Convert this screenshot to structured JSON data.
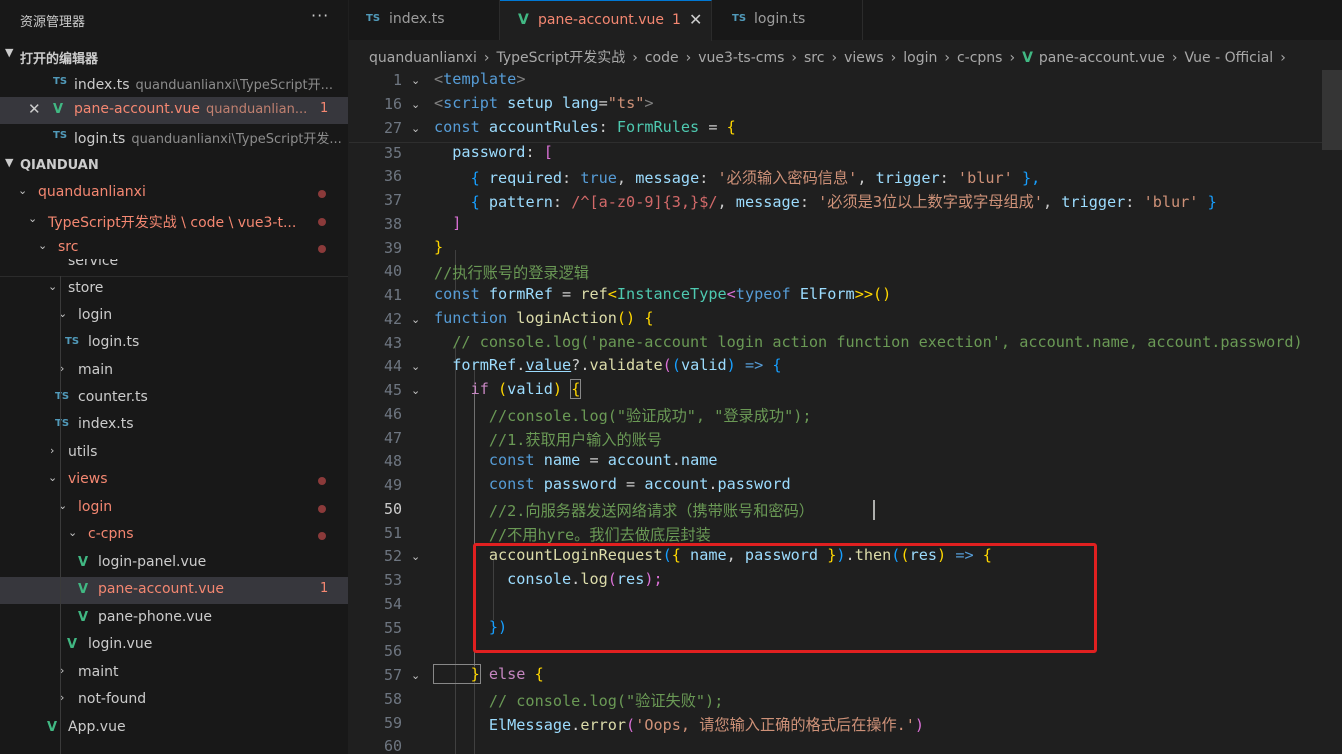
{
  "sidebar": {
    "title": "资源管理器",
    "more": "···",
    "open_editors_header": "打开的编辑器",
    "open_editors": [
      {
        "icon": "TS",
        "name": "index.ts",
        "desc": "quanduanlianxi\\TypeScript开..."
      },
      {
        "icon": "V",
        "name": "pane-account.vue",
        "desc": "quanduanlian...",
        "count": "1",
        "close": "✕"
      },
      {
        "icon": "TS",
        "name": "login.ts",
        "desc": "quanduanlianxi\\TypeScript开发..."
      }
    ],
    "workspace_header": "QIANDUAN",
    "tree": [
      {
        "label": "quanduanlianxi"
      },
      {
        "label": "TypeScript开发实战 \\ code \\ vue3-t..."
      },
      {
        "label": "src"
      },
      {
        "label": "service"
      },
      {
        "label": "store"
      },
      {
        "label": "login"
      },
      {
        "label": "login.ts",
        "icon": "TS"
      },
      {
        "label": "main"
      },
      {
        "label": "counter.ts",
        "icon": "TS"
      },
      {
        "label": "index.ts",
        "icon": "TS"
      },
      {
        "label": "utils"
      },
      {
        "label": "views"
      },
      {
        "label": "login"
      },
      {
        "label": "c-cpns"
      },
      {
        "label": "login-panel.vue",
        "icon": "V"
      },
      {
        "label": "pane-account.vue",
        "icon": "V",
        "count": "1"
      },
      {
        "label": "pane-phone.vue",
        "icon": "V"
      },
      {
        "label": "login.vue",
        "icon": "V"
      },
      {
        "label": "maint"
      },
      {
        "label": "not-found"
      },
      {
        "label": "App.vue",
        "icon": "V"
      }
    ]
  },
  "tabs": [
    {
      "icon": "TS",
      "label": "index.ts"
    },
    {
      "icon": "V",
      "label": "pane-account.vue",
      "count": "1",
      "close": "✕"
    },
    {
      "icon": "TS",
      "label": "login.ts"
    }
  ],
  "breadcrumb": [
    "quanduanlianxi",
    "TypeScript开发实战",
    "code",
    "vue3-ts-cms",
    "src",
    "views",
    "login",
    "c-cpns",
    "pane-account.vue",
    "Vue - Official"
  ],
  "editor": {
    "line_numbers": [
      "1",
      "16",
      "27",
      "35",
      "36",
      "37",
      "38",
      "39",
      "40",
      "41",
      "42",
      "43",
      "44",
      "45",
      "46",
      "47",
      "48",
      "49",
      "50",
      "51",
      "52",
      "53",
      "54",
      "55",
      "56",
      "57",
      "58",
      "59",
      "60"
    ],
    "lines": {
      "l1_a": "<",
      "l1_b": "template",
      "l1_c": ">",
      "l16_a": "<",
      "l16_b": "script",
      "l16_c": " setup",
      "l16_d": " lang",
      "l16_e": "=",
      "l16_f": "\"ts\"",
      "l16_g": ">",
      "l27_a": "const",
      "l27_b": " accountRules",
      "l27_c": ": ",
      "l27_d": "FormRules",
      "l27_e": " = ",
      "l27_f": "{",
      "l35_a": "  password",
      "l35_b": ": ",
      "l35_c": "[",
      "l36_a": "    { ",
      "l36_b": "required",
      "l36_c": ": ",
      "l36_d": "true",
      "l36_e": ", ",
      "l36_f": "message",
      "l36_g": ": ",
      "l36_h": "'必须输入密码信息'",
      "l36_i": ", ",
      "l36_j": "trigger",
      "l36_k": ": ",
      "l36_l": "'blur'",
      "l36_m": " },",
      "l37_a": "    { ",
      "l37_b": "pattern",
      "l37_c": ": ",
      "l37_d": "/^[a-z0-9]{3,}$/",
      "l37_e": ", ",
      "l37_f": "message",
      "l37_g": ": ",
      "l37_h": "'必须是3位以上数字或字母组成'",
      "l37_i": ", ",
      "l37_j": "trigger",
      "l37_k": ": ",
      "l37_l": "'blur'",
      "l37_m": " }",
      "l38_a": "  ]",
      "l39_a": "}",
      "l40_a": "//执行账号的登录逻辑",
      "l41_a": "const",
      "l41_b": " formRef",
      "l41_c": " = ",
      "l41_d": "ref",
      "l41_e": "<",
      "l41_f": "InstanceType",
      "l41_g": "<",
      "l41_h": "typeof",
      "l41_i": " ElForm",
      "l41_j": ">>",
      "l41_k": "()",
      "l42_a": "function",
      "l42_b": " loginAction",
      "l42_c": "()",
      "l42_d": " {",
      "l43_a": "  // console.log('pane-account login action function exection', account.name, account.password)",
      "l44_a": "  formRef",
      "l44_b": ".",
      "l44_c": "value",
      "l44_d": "?.",
      "l44_e": "validate",
      "l44_f": "(",
      "l44_g": "(",
      "l44_h": "valid",
      "l44_i": ")",
      "l44_j": " => ",
      "l44_k": "{",
      "l45_a": "    if",
      "l45_b": " (",
      "l45_c": "valid",
      "l45_d": ") ",
      "l45_e": "{",
      "l46_a": "      //console.log(\"验证成功\", \"登录成功\");",
      "l47_a": "      //1.获取用户输入的账号",
      "l48_a": "      const",
      "l48_b": " name",
      "l48_c": " = ",
      "l48_d": "account",
      "l48_e": ".",
      "l48_f": "name",
      "l49_a": "      const",
      "l49_b": " password",
      "l49_c": " = ",
      "l49_d": "account",
      "l49_e": ".",
      "l49_f": "password",
      "l50_a": "      //2.向服务器发送网络请求（携带账号和密码）",
      "l51_a": "      //不用hyre。我们去做底层封装",
      "l52_a": "      accountLoginRequest",
      "l52_b": "(",
      "l52_c": "{ ",
      "l52_d": "name",
      "l52_e": ", ",
      "l52_f": "password",
      "l52_g": " }",
      "l52_h": ")",
      "l52_i": ".",
      "l52_j": "then",
      "l52_k": "(",
      "l52_l": "(",
      "l52_m": "res",
      "l52_n": ")",
      "l52_o": " => ",
      "l52_p": "{",
      "l53_a": "        console",
      "l53_b": ".",
      "l53_c": "log",
      "l53_d": "(",
      "l53_e": "res",
      "l53_f": ");",
      "l55_a": "      })",
      "l57_a": "    }",
      "l57_b": " else ",
      "l57_c": "{",
      "l58_a": "      // console.log(\"验证失败\");",
      "l59_a": "      ElMessage",
      "l59_b": ".",
      "l59_c": "error",
      "l59_d": "(",
      "l59_e": "'Oops, 请您输入正确的格式后在操作.'",
      "l59_f": ")"
    }
  },
  "colors": {
    "accent": "#0078d4",
    "modified": "#f48771",
    "highlight_box": "#e02020"
  }
}
